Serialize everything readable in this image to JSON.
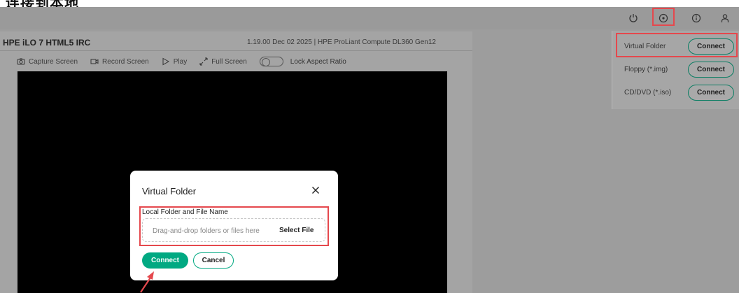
{
  "caption": {
    "text": "连接到本地"
  },
  "topbar": {
    "icons": [
      "power-icon",
      "virtual-media-icon",
      "info-icon",
      "user-icon"
    ]
  },
  "console": {
    "title": "HPE iLO 7 HTML5 IRC",
    "meta": "1.19.00 Dec 02 2025  |  HPE ProLiant Compute DL360 Gen12",
    "toolbar": {
      "capture_label": "Capture Screen",
      "record_label": "Record Screen",
      "play_label": "Play",
      "fullscreen_label": "Full Screen",
      "lock_label": "Lock Aspect Ratio"
    }
  },
  "media_menu": {
    "items": [
      {
        "label": "Virtual Folder",
        "button": "Connect"
      },
      {
        "label": "Floppy (*.img)",
        "button": "Connect"
      },
      {
        "label": "CD/DVD (*.iso)",
        "button": "Connect"
      }
    ]
  },
  "modal": {
    "title": "Virtual Folder",
    "field_label": "Local Folder and File Name",
    "dropzone_placeholder": "Drag-and-drop folders or files here",
    "select_file_label": "Select File",
    "connect_label": "Connect",
    "cancel_label": "Cancel"
  },
  "colors": {
    "accent": "#01a982",
    "highlight": "#e5484d",
    "overlay": "#9d9d9d"
  }
}
